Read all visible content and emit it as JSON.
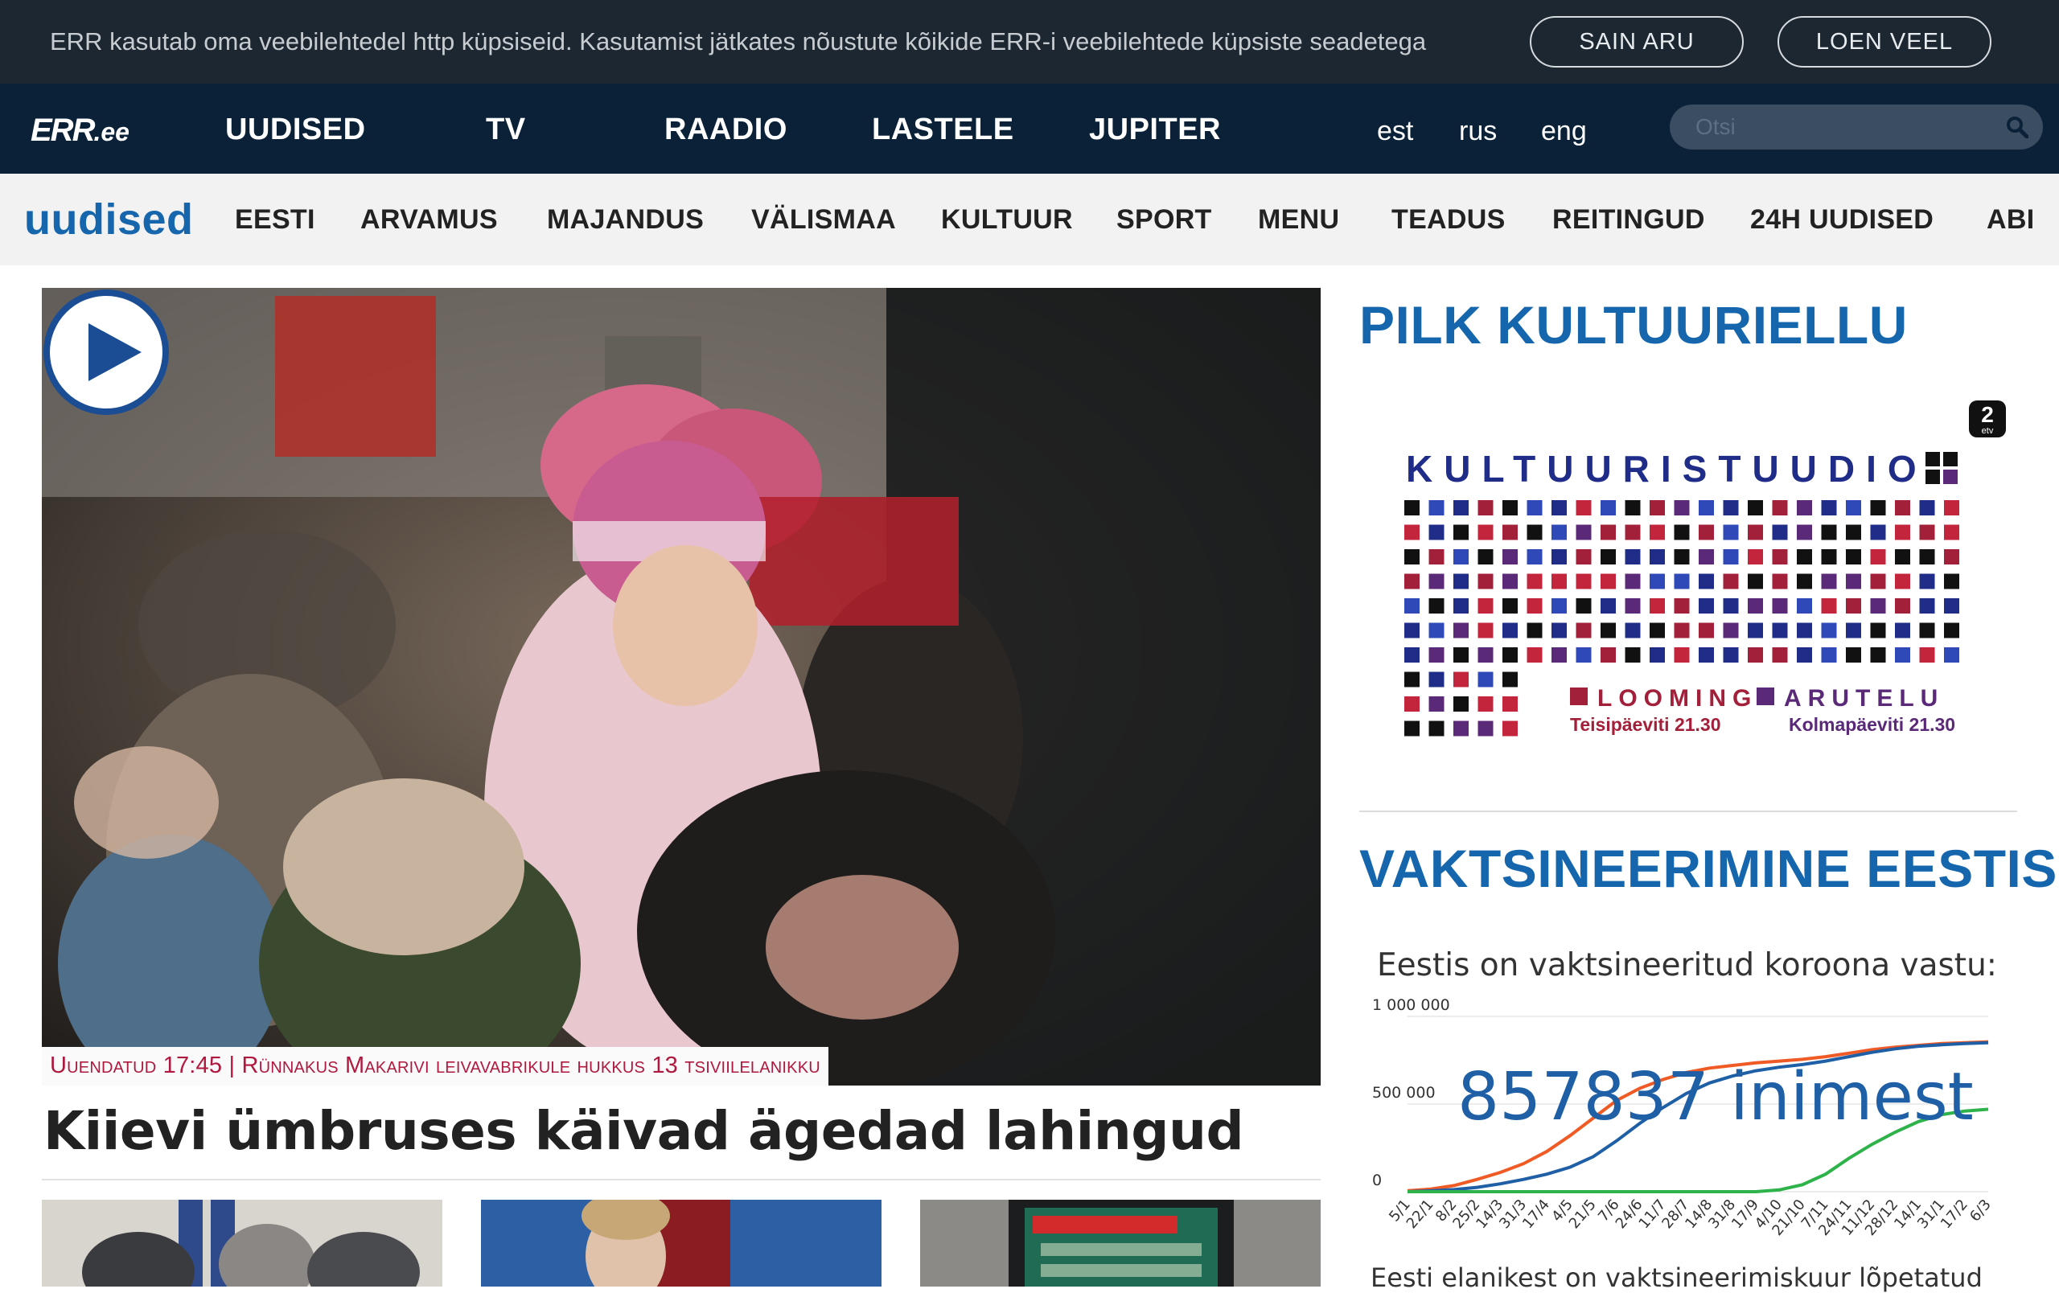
{
  "cookie": {
    "text": "ERR kasutab oma veebilehtedel http küpsiseid. Kasutamist jätkates nõustute kõikide ERR-i veebilehtede küpsiste seadetega",
    "agree_label": "SAIN ARU",
    "more_label": "LOEN VEEL"
  },
  "nav": {
    "logo_main": "ERR",
    "logo_suffix": ".ee",
    "items": [
      "UUDISED",
      "TV",
      "RAADIO",
      "LASTELE",
      "JUPITER"
    ],
    "languages": [
      "est",
      "rus",
      "eng"
    ],
    "search_placeholder": "Otsi"
  },
  "subnav": {
    "brand": "uudised",
    "items": [
      "EESTI",
      "ARVAMUS",
      "MAJANDUS",
      "VÄLISMAA",
      "KULTUUR",
      "SPORT",
      "MENU",
      "TEADUS",
      "REITINGUD",
      "24H UUDISED",
      "ABI"
    ]
  },
  "hero": {
    "caption": "Uuendatud 17:45 | Rünnakus Makarivi leivavabrikule hukkus 13 tsiviilelanikku",
    "headline": "Kiievi ümbruses käivad ägedad lahingud"
  },
  "sidebar": {
    "promo_title": "PILK KULTUURIELLU",
    "promo": {
      "channel_badge": "2",
      "channel_sub": "etv",
      "title": "KULTUURISTUUDIO",
      "tag1": "LOOMING",
      "tag1_time": "Teisipäeviti 21.30",
      "tag2": "ARUTELU",
      "tag2_time": "Kolmapäeviti 21.30"
    },
    "vax_title": "VAKTSINEERIMINE EESTIS",
    "vax_caption": "Eestis on vaktsineeritud koroona vastu:",
    "vax_big_number": "857837 inimest",
    "vax_footer": "Eesti elanikest on vaktsineerimiskuur lõpetatud"
  },
  "colors": {
    "cookie_bg": "#1c2731",
    "nav_bg": "#0a2138",
    "brand_blue": "#1566ad",
    "caption_red": "#b0193f",
    "series_orange": "#f05a24",
    "series_blue": "#1f5fa6",
    "series_green": "#2eb24a"
  },
  "chart_data": {
    "type": "line",
    "ylim": [
      0,
      1000000
    ],
    "yticks": [
      "1 000 000",
      "500 000",
      "0"
    ],
    "x": [
      "5/1",
      "22/1",
      "8/2",
      "25/2",
      "14/3",
      "31/3",
      "17/4",
      "4/5",
      "21/5",
      "7/6",
      "24/6",
      "11/7",
      "28/7",
      "14/8",
      "31/8",
      "17/9",
      "4/10",
      "21/10",
      "7/11",
      "24/11",
      "11/12",
      "28/12",
      "14/1",
      "31/1",
      "17/2",
      "6/3"
    ],
    "series": [
      {
        "values": [
          5000,
          15000,
          35000,
          70000,
          110000,
          160000,
          230000,
          320000,
          420000,
          520000,
          590000,
          640000,
          680000,
          705000,
          720000,
          735000,
          745000,
          755000,
          770000,
          790000,
          810000,
          825000,
          835000,
          845000,
          850000,
          855000
        ]
      },
      {
        "values": [
          0,
          5000,
          12000,
          25000,
          45000,
          70000,
          100000,
          140000,
          200000,
          290000,
          390000,
          480000,
          560000,
          620000,
          660000,
          690000,
          710000,
          725000,
          745000,
          770000,
          795000,
          815000,
          830000,
          838000,
          845000,
          850000
        ]
      },
      {
        "values": [
          0,
          0,
          0,
          0,
          0,
          0,
          0,
          0,
          0,
          0,
          0,
          0,
          0,
          0,
          0,
          0,
          10000,
          40000,
          100000,
          190000,
          270000,
          340000,
          400000,
          440000,
          460000,
          470000
        ]
      }
    ]
  }
}
